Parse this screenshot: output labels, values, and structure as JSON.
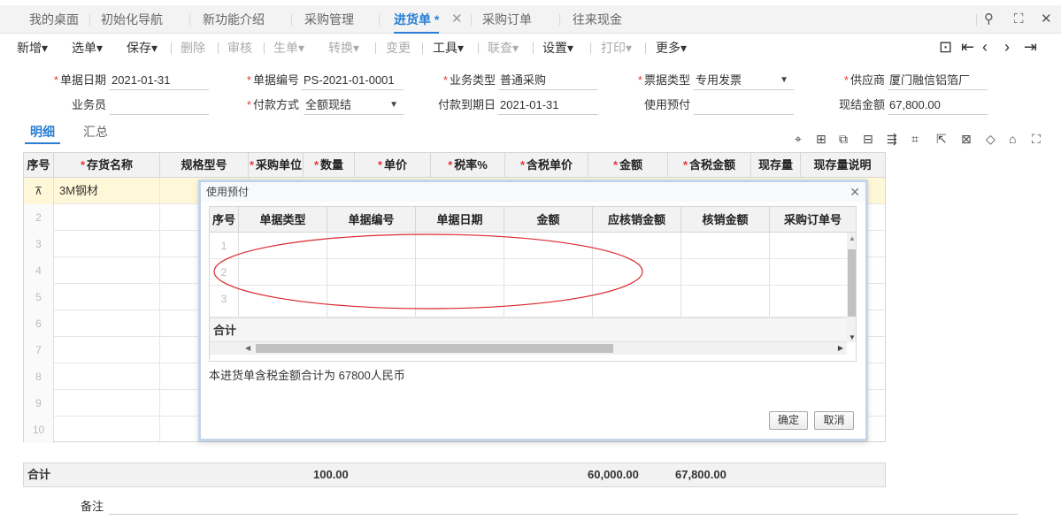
{
  "tabs": [
    {
      "label": "我的桌面",
      "active": false
    },
    {
      "label": "初始化导航",
      "active": false
    },
    {
      "label": "新功能介绍",
      "active": false
    },
    {
      "label": "采购管理",
      "active": false
    },
    {
      "label": "进货单 *",
      "active": true
    },
    {
      "label": "采购订单",
      "active": false
    },
    {
      "label": "往来现金",
      "active": false
    }
  ],
  "toolbar": {
    "new": "新增▾",
    "select": "选单▾",
    "save": "保存▾",
    "delete": "删除",
    "audit": "审核",
    "generate": "生单▾",
    "convert": "转换▾",
    "change": "变更",
    "tools": "工具▾",
    "query": "联查▾",
    "settings": "设置▾",
    "print": "打印▾",
    "more": "更多▾"
  },
  "form": {
    "doc_date_label": "单据日期",
    "doc_date": "2021-01-31",
    "doc_no_label": "单据编号",
    "doc_no": "PS-2021-01-0001",
    "biz_type_label": "业务类型",
    "biz_type": "普通采购",
    "invoice_type_label": "票据类型",
    "invoice_type": "专用发票",
    "supplier_label": "供应商",
    "supplier": "厦门融信铝箔厂",
    "staff_label": "业务员",
    "staff": "",
    "pay_method_label": "付款方式",
    "pay_method": "全额现结",
    "due_date_label": "付款到期日",
    "due_date": "2021-01-31",
    "prepay_label": "使用预付",
    "prepay": "",
    "cash_amount_label": "现结金额",
    "cash_amount": "67,800.00"
  },
  "subtabs": {
    "detail": "明细",
    "summary": "汇总"
  },
  "grid": {
    "columns": [
      "序号",
      "存货名称",
      "规格型号",
      "采购单位",
      "数量",
      "单价",
      "税率%",
      "含税单价",
      "金额",
      "含税金额",
      "现存量",
      "现存量说明"
    ],
    "required": [
      false,
      true,
      false,
      true,
      true,
      true,
      true,
      true,
      true,
      true,
      false,
      false
    ],
    "rows": [
      {
        "num": "",
        "name": "3M钢材"
      },
      {
        "num": "2"
      },
      {
        "num": "3"
      },
      {
        "num": "4"
      },
      {
        "num": "5"
      },
      {
        "num": "6"
      },
      {
        "num": "7"
      },
      {
        "num": "8"
      },
      {
        "num": "9"
      },
      {
        "num": "10"
      }
    ]
  },
  "totals": {
    "label": "合计",
    "qty": "100.00",
    "amount": "60,000.00",
    "tax_amount": "67,800.00"
  },
  "remark_label": "备注",
  "dialog": {
    "title": "使用预付",
    "columns": [
      "序号",
      "单据类型",
      "单据编号",
      "单据日期",
      "金额",
      "应核销金额",
      "核销金额",
      "采购订单号"
    ],
    "rows": [
      "1",
      "2",
      "3"
    ],
    "total_label": "合计",
    "message": "本进货单含税金额合计为 67800人民币",
    "ok": "确定",
    "cancel": "取消"
  },
  "colors": {
    "accent": "#2a7fd4",
    "required": "#e5383b",
    "annotation": "#d9262c",
    "selected_row": "#fff8d8"
  }
}
